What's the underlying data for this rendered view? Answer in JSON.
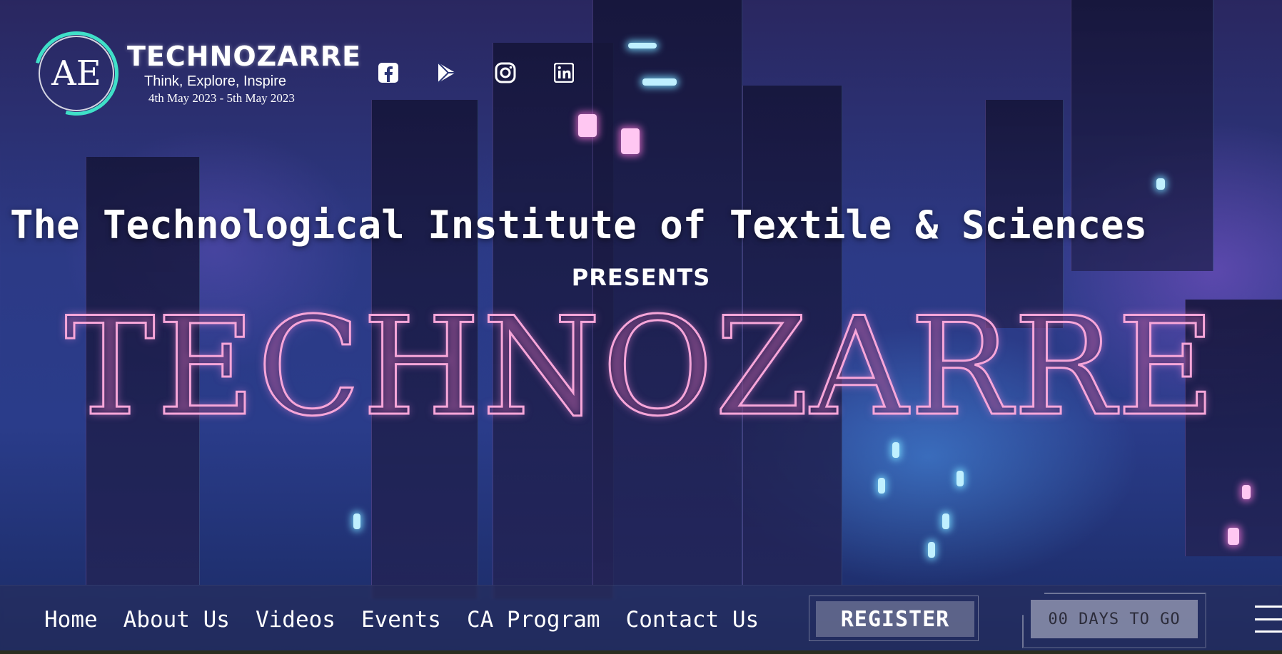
{
  "header": {
    "logo_monogram": "AE",
    "brand_title": "TECHNOZARRE",
    "tagline": "Think, Explore, Inspire",
    "dates": "4th May 2023 - 5th May 2023"
  },
  "socials": [
    {
      "icon": "facebook-icon"
    },
    {
      "icon": "play-store-icon"
    },
    {
      "icon": "instagram-icon"
    },
    {
      "icon": "linkedin-icon"
    }
  ],
  "hero": {
    "institute": "The Technological Institute of Textile & Sciences",
    "presents": "PRESENTS",
    "event_name": "TECHNOZARRE"
  },
  "nav": {
    "items": [
      "Home",
      "About Us",
      "Videos",
      "Events",
      "CA Program",
      "Contact Us"
    ],
    "register_label": "REGISTER",
    "countdown_label": "00 DAYS TO GO",
    "menu_icon": "hamburger-menu-icon"
  },
  "colors": {
    "accent_teal": "#3fe0c8",
    "title_pink": "#f7a6d9",
    "nav_bg": "#282d5a"
  }
}
